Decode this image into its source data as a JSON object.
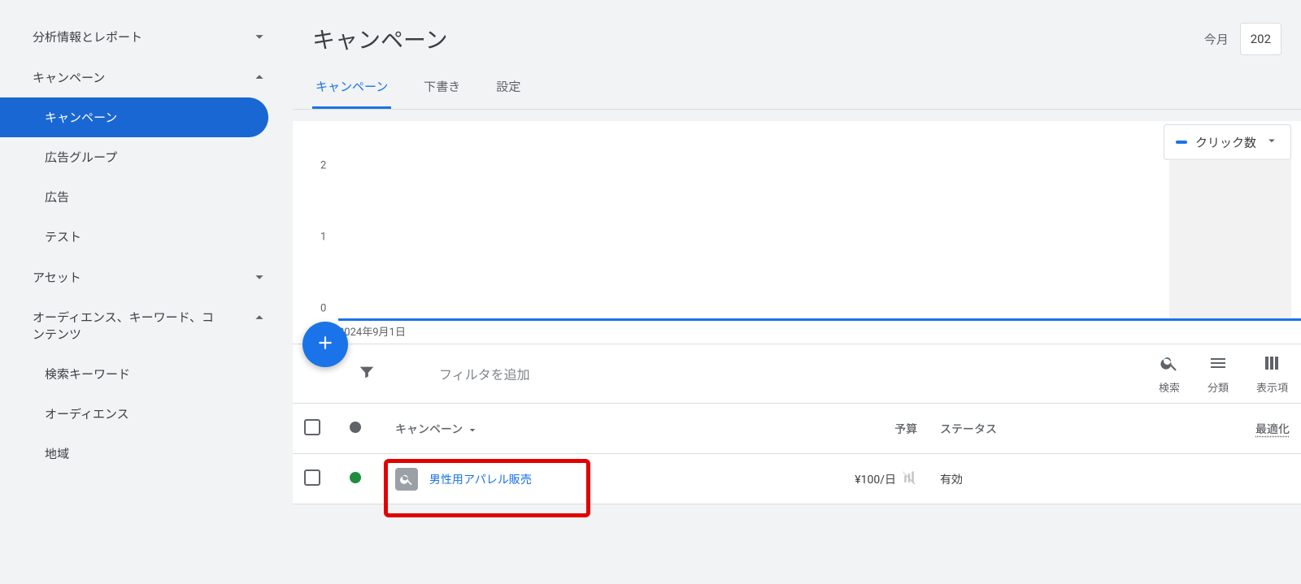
{
  "sidebar": {
    "groups": {
      "insights": {
        "label": "分析情報とレポート"
      },
      "campaigns": {
        "label": "キャンペーン"
      },
      "assets": {
        "label": "アセット"
      },
      "audiences": {
        "label": "オーディエンス、キーワード、コンテンツ"
      }
    },
    "campaign_items": {
      "campaigns": "キャンペーン",
      "ad_groups": "広告グループ",
      "ads": "広告",
      "tests": "テスト"
    },
    "audience_items": {
      "search_keywords": "検索キーワード",
      "audiences": "オーディエンス",
      "locations": "地域"
    }
  },
  "page": {
    "title": "キャンペーン",
    "date_label": "今月",
    "date_range": "202"
  },
  "tabs": {
    "campaigns": "キャンペーン",
    "drafts": "下書き",
    "settings": "設定"
  },
  "metric": {
    "label": "クリック数"
  },
  "chart_data": {
    "type": "line",
    "x_start_label": "2024年9月1日",
    "y_ticks": [
      "0",
      "1",
      "2"
    ],
    "ylim": [
      0,
      2
    ],
    "series": [
      {
        "name": "クリック数",
        "values": [
          0
        ],
        "color": "#1a73e8"
      }
    ]
  },
  "toolbar": {
    "filter_placeholder": "フィルタを追加",
    "actions": {
      "search": "検索",
      "segment": "分類",
      "columns": "表示項"
    }
  },
  "table": {
    "headers": {
      "campaign": "キャンペーン",
      "budget": "予算",
      "status": "ステータス",
      "optimization": "最適化"
    },
    "rows": [
      {
        "name": "男性用アパレル販売",
        "budget": "¥100/日",
        "status": "有効",
        "status_color": "green"
      }
    ]
  }
}
